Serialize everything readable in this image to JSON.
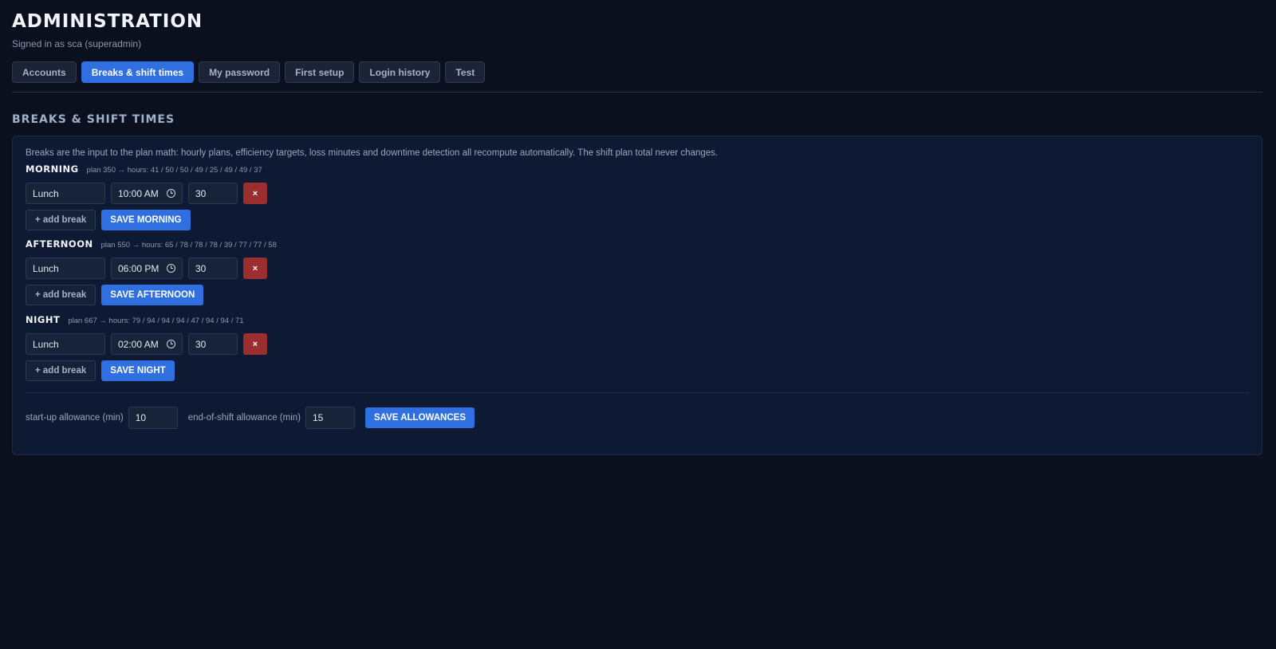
{
  "header": {
    "title": "ADMINISTRATION",
    "subtitle": "Signed in as sca (superadmin)"
  },
  "tabs": [
    {
      "label": "Accounts",
      "active": false
    },
    {
      "label": "Breaks & shift times",
      "active": true
    },
    {
      "label": "My password",
      "active": false
    },
    {
      "label": "First setup",
      "active": false
    },
    {
      "label": "Login history",
      "active": false
    },
    {
      "label": "Test",
      "active": false
    }
  ],
  "section": {
    "title": "BREAKS & SHIFT TIMES",
    "intro": "Breaks are the input to the plan math: hourly plans, efficiency targets, loss minutes and downtime detection all recompute automatically. The shift plan total never changes."
  },
  "shifts": [
    {
      "name": "MORNING",
      "meta": "plan 350 → hours: 41 / 50 / 50 / 49 / 25 / 49 / 49 / 37",
      "breaks": [
        {
          "name": "Lunch",
          "time": "10:00 AM",
          "duration": "30",
          "delete_label": "×"
        }
      ],
      "add_label": "+ add break",
      "save_label": "SAVE MORNING"
    },
    {
      "name": "AFTERNOON",
      "meta": "plan 550 → hours: 65 / 78 / 78 / 78 / 39 / 77 / 77 / 58",
      "breaks": [
        {
          "name": "Lunch",
          "time": "06:00 PM",
          "duration": "30",
          "delete_label": "×"
        }
      ],
      "add_label": "+ add break",
      "save_label": "SAVE AFTERNOON"
    },
    {
      "name": "NIGHT",
      "meta": "plan 667 → hours: 79 / 94 / 94 / 94 / 47 / 94 / 94 / 71",
      "breaks": [
        {
          "name": "Lunch",
          "time": "02:00 AM",
          "duration": "30",
          "delete_label": "×"
        }
      ],
      "add_label": "+ add break",
      "save_label": "SAVE NIGHT"
    }
  ],
  "allowances": {
    "startup_label": "start-up allowance (min)",
    "startup_value": "10",
    "end_label": "end-of-shift allowance (min)",
    "end_value": "15",
    "save_label": "SAVE ALLOWANCES"
  },
  "colors": {
    "background": "#0a101d",
    "panel": "#0e1a33",
    "accent": "#2f6fe0",
    "danger": "#9b2f2f"
  },
  "icons": {
    "time_picker": "clock-icon"
  }
}
